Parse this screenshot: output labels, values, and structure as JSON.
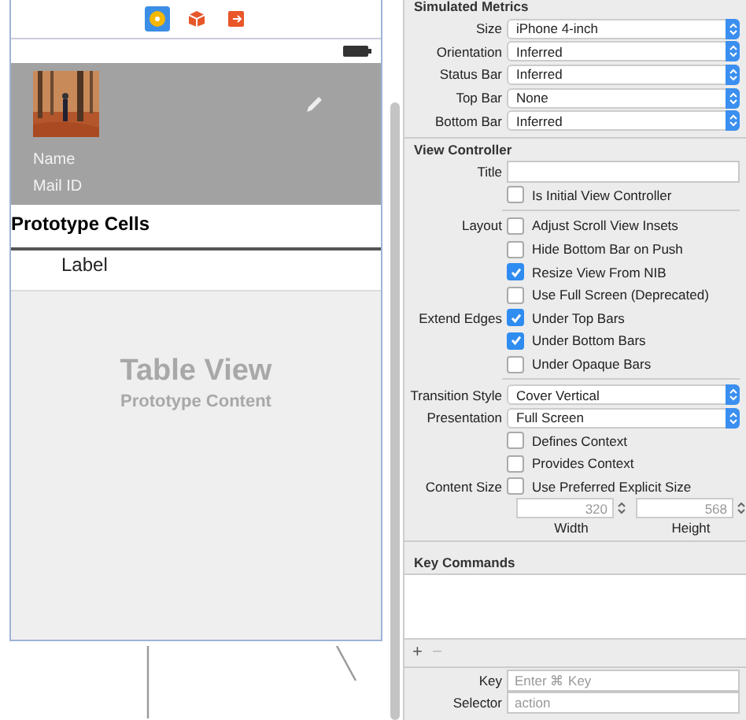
{
  "canvas": {
    "toolbar_icons": [
      {
        "selected": true
      },
      {
        "selected": false
      },
      {
        "selected": false
      }
    ],
    "header": {
      "name": "Name",
      "mail": "Mail ID"
    },
    "section_title": "Prototype Cells",
    "cell_label": "Label",
    "table_title": "Table View",
    "table_subtitle": "Prototype Content"
  },
  "inspector": {
    "metrics": {
      "title": "Simulated Metrics",
      "rows": [
        {
          "label": "Size",
          "value": "iPhone 4-inch"
        },
        {
          "label": "Orientation",
          "value": "Inferred"
        },
        {
          "label": "Status Bar",
          "value": "Inferred"
        },
        {
          "label": "Top Bar",
          "value": "None"
        },
        {
          "label": "Bottom Bar",
          "value": "Inferred"
        }
      ]
    },
    "view_controller": {
      "title": "View Controller",
      "groups": [
        [
          {
            "kind": "text",
            "label": "Title"
          },
          {
            "kind": "check",
            "text": "Is Initial View Controller",
            "checked": false
          }
        ],
        [
          {
            "kind": "check",
            "label": "Layout",
            "text": "Adjust Scroll View Insets",
            "checked": false
          },
          {
            "kind": "check",
            "text": "Hide Bottom Bar on Push",
            "checked": false
          },
          {
            "kind": "check",
            "text": "Resize View From NIB",
            "checked": true
          },
          {
            "kind": "check",
            "text": "Use Full Screen (Deprecated)",
            "checked": false
          },
          {
            "kind": "check",
            "label": "Extend Edges",
            "text": "Under Top Bars",
            "checked": true
          },
          {
            "kind": "check",
            "text": "Under Bottom Bars",
            "checked": true
          },
          {
            "kind": "check",
            "text": "Under Opaque Bars",
            "checked": false
          }
        ],
        [
          {
            "kind": "select",
            "label": "Transition Style",
            "value": "Cover Vertical"
          },
          {
            "kind": "select",
            "label": "Presentation",
            "value": "Full Screen"
          },
          {
            "kind": "check",
            "text": "Defines Context",
            "checked": false
          },
          {
            "kind": "check",
            "text": "Provides Context",
            "checked": false
          },
          {
            "kind": "check",
            "label": "Content Size",
            "text": "Use Preferred Explicit Size",
            "checked": false
          },
          {
            "kind": "sizes",
            "fields": [
              {
                "placeholder": "320",
                "caption": "Width"
              },
              {
                "placeholder": "568",
                "caption": "Height"
              }
            ]
          }
        ]
      ]
    },
    "key_commands": {
      "title": "Key Commands",
      "add": "+",
      "remove": "−",
      "fields": [
        {
          "label": "Key",
          "placeholder": "Enter ⌘ Key"
        },
        {
          "label": "Selector",
          "placeholder": "action"
        }
      ]
    }
  }
}
